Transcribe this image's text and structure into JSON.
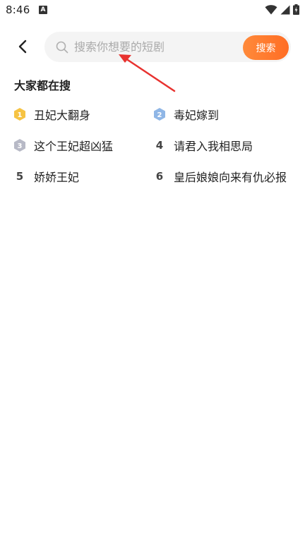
{
  "status_bar": {
    "time": "8:46",
    "app_icon_letter": "A",
    "icons": [
      "wifi-icon",
      "signal-icon",
      "battery-icon"
    ]
  },
  "header": {
    "back_icon": "chevron-left-icon",
    "search": {
      "placeholder": "搜索你想要的短剧",
      "value": "",
      "icon": "search-icon",
      "button_label": "搜索"
    }
  },
  "hot_section": {
    "title": "大家都在搜",
    "items": [
      {
        "rank": "1",
        "title": "丑妃大翻身",
        "badge_color": "#f6c343"
      },
      {
        "rank": "2",
        "title": "毒妃嫁到",
        "badge_color": "#8fb6e6"
      },
      {
        "rank": "3",
        "title": "这个王妃超凶猛",
        "badge_color": "#b7b9c6"
      },
      {
        "rank": "4",
        "title": "请君入我相思局"
      },
      {
        "rank": "5",
        "title": "娇娇王妃"
      },
      {
        "rank": "6",
        "title": "皇后娘娘向来有仇必报"
      }
    ]
  },
  "colors": {
    "accent": "#ff7a2f",
    "annotation": "#e8322f"
  }
}
